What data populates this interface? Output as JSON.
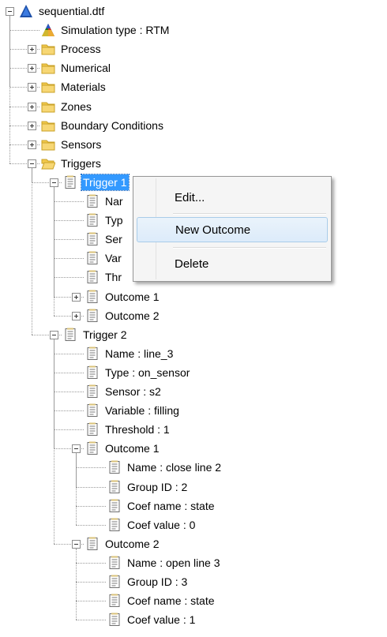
{
  "tree": {
    "root_label": "sequential.dtf",
    "simulation_type": "Simulation type : RTM",
    "folders": [
      "Process",
      "Numerical",
      "Materials",
      "Zones",
      "Boundary Conditions",
      "Sensors"
    ],
    "triggers_label": "Triggers",
    "trigger1": {
      "label": "Trigger 1",
      "children_visible": [
        "Nar",
        "Typ",
        "Ser",
        "Var",
        "Thr"
      ],
      "outcomes": [
        "Outcome 1",
        "Outcome 2"
      ]
    },
    "trigger2": {
      "label": "Trigger 2",
      "props": [
        "Name : line_3",
        "Type : on_sensor",
        "Sensor : s2",
        "Variable : filling",
        "Threshold : 1"
      ],
      "outcome1": {
        "label": "Outcome 1",
        "props": [
          "Name : close line 2",
          "Group ID : 2",
          "Coef name : state",
          "Coef value : 0"
        ]
      },
      "outcome2": {
        "label": "Outcome 2",
        "props": [
          "Name : open line 3",
          "Group ID : 3",
          "Coef name : state",
          "Coef value : 1"
        ]
      }
    }
  },
  "context_menu": {
    "edit": "Edit...",
    "new_outcome": "New Outcome",
    "delete": "Delete"
  },
  "colors": {
    "selection": "#3399ff",
    "menu_highlight": "#dcebfa",
    "folder": "#f2c94c"
  },
  "icon_names": {
    "root": "simulation-triangle-icon",
    "folder": "folder-icon",
    "open_folder": "open-folder-icon",
    "document": "document-icon"
  }
}
